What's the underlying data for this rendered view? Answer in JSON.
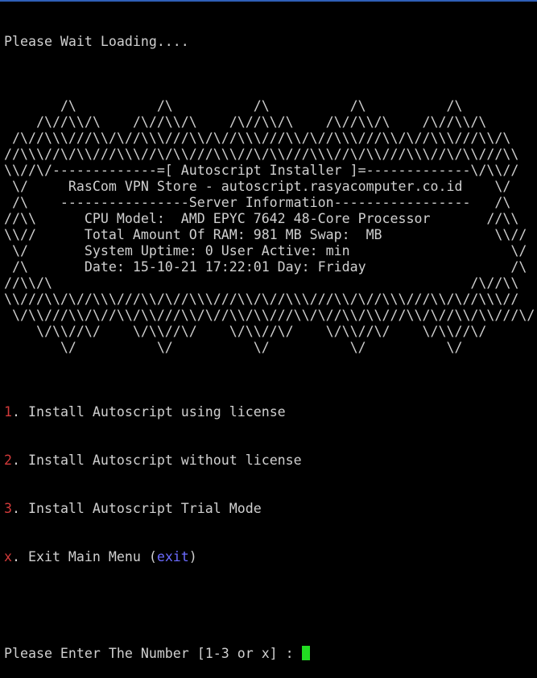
{
  "loading": "Please Wait Loading....",
  "banner": [
    "",
    "       /\\          /\\          /\\          /\\          /\\",
    "    /\\//\\\\/\\    /\\//\\\\/\\    /\\//\\\\/\\    /\\//\\\\/\\    /\\//\\\\/\\",
    " /\\//\\\\\\///\\\\/\\//\\\\\\///\\\\/\\//\\\\\\///\\\\/\\//\\\\\\///\\\\/\\//\\\\\\///\\\\/\\",
    "//\\\\\\//\\/\\\\///\\\\\\//\\/\\\\///\\\\\\//\\/\\\\///\\\\\\//\\/\\\\///\\\\\\//\\/\\\\///\\\\",
    "\\\\//\\/-------------=[ Autoscript Installer ]=-------------\\/\\\\//",
    " \\/     RasCom VPN Store - autoscript.rasyacomputer.co.id    \\/",
    " /\\    ----------------Server Information-----------------   /\\",
    "//\\\\      CPU Model:  AMD EPYC 7642 48-Core Processor       //\\\\",
    "\\\\//      Total Amount Of RAM: 981 MB Swap:  MB              \\\\//",
    " \\/       System Uptime: 0 User Active: min                    \\/",
    " /\\       Date: 15-10-21 17:22:01 Day: Friday                  /\\",
    "//\\\\/\\                                                    /\\//\\\\",
    "\\\\///\\\\/\\//\\\\\\///\\\\/\\//\\\\\\///\\\\/\\//\\\\\\///\\\\/\\//\\\\\\///\\\\/\\//\\\\\\//",
    " \\/\\\\///\\\\/\\//\\\\/\\\\///\\\\/\\//\\\\/\\\\///\\\\/\\//\\\\/\\\\///\\\\/\\//\\\\/\\\\///\\/",
    "    \\/\\\\//\\/    \\/\\\\//\\/    \\/\\\\//\\/    \\/\\\\//\\/    \\/\\\\//\\/",
    "       \\/          \\/          \\/          \\/          \\/",
    ""
  ],
  "menu": [
    {
      "num": "1",
      "label": ". Install Autoscript using license"
    },
    {
      "num": "2",
      "label": ". Install Autoscript without license"
    },
    {
      "num": "3",
      "label": ". Install Autoscript Trial Mode"
    },
    {
      "num": "x",
      "label": ". Exit Main Menu (",
      "link": "exit",
      "after": ")"
    }
  ],
  "prompt": "Please Enter The Number [1-3 or x] : ",
  "colors": {
    "text": "#d0d0d0",
    "menu_number": "#d23a3a",
    "link": "#6b6bff",
    "cursor": "#22dd22"
  }
}
